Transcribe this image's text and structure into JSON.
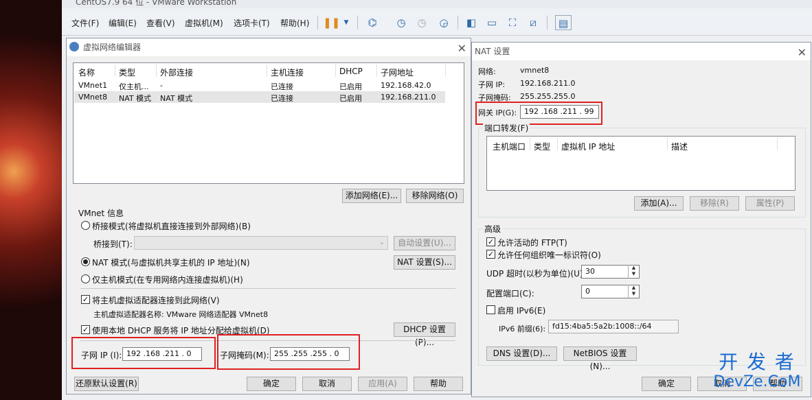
{
  "app": {
    "title": "CentOS7.9 64 位 - VMware Workstation"
  },
  "menus": [
    "文件(F)",
    "编辑(E)",
    "查看(V)",
    "虚拟机(M)",
    "选项卡(T)",
    "帮助(H)"
  ],
  "vne": {
    "title": "虚拟网络编辑器",
    "headers": [
      "名称",
      "类型",
      "外部连接",
      "主机连接",
      "DHCP",
      "子网地址"
    ],
    "rows": [
      [
        "VMnet1",
        "仅主机...",
        "-",
        "已连接",
        "已启用",
        "192.168.42.0"
      ],
      [
        "VMnet8",
        "NAT 模式",
        "NAT 模式",
        "已连接",
        "已启用",
        "192.168.211.0"
      ]
    ],
    "add_network": "添加网络(E)...",
    "remove_network": "移除网络(O)",
    "vmnet_info": "VMnet 信息",
    "bridge_mode": "桥接模式(将虚拟机直接连接到外部网络)(B)",
    "bridge_to": "桥接到(T):",
    "auto_settings": "自动设置(U)...",
    "nat_mode": "NAT 模式(与虚拟机共享主机的 IP 地址)(N)",
    "nat_settings": "NAT 设置(S)...",
    "host_only": "仅主机模式(在专用网络内连接虚拟机)(H)",
    "connect_adapter": "将主机虚拟适配器连接到此网络(V)",
    "adapter_name": "主机虚拟适配器名称: VMware 网络适配器 VMnet8",
    "use_dhcp": "使用本地 DHCP 服务将 IP 地址分配给虚拟机(D)",
    "dhcp_settings": "DHCP 设置(P)...",
    "subnet_ip_label": "子网 IP (I):",
    "subnet_ip": "192 .168 .211 . 0",
    "subnet_mask_label": "子网掩码(M):",
    "subnet_mask": "255 .255 .255 . 0",
    "restore_default": "还原默认设置(R)",
    "ok": "确定",
    "cancel": "取消",
    "apply": "应用(A)",
    "help": "帮助"
  },
  "nat": {
    "title": "NAT 设置",
    "network_label": "网络:",
    "network": "vmnet8",
    "subnet_ip_label": "子网 IP:",
    "subnet_ip": "192.168.211.0",
    "subnet_mask_label": "子网掩码:",
    "subnet_mask": "255.255.255.0",
    "gateway_label": "网关 IP(G):",
    "gateway": "192 .168 .211 . 99",
    "port_forward": "端口转发(F)",
    "pf_headers": [
      "主机端口",
      "类型",
      "虚拟机 IP 地址",
      "描述"
    ],
    "add": "添加(A)...",
    "remove": "移除(R)",
    "properties": "属性(P)",
    "advanced": "高级",
    "allow_ftp": "允许活动的 FTP(T)",
    "allow_oui": "允许任何组织唯一标识符(O)",
    "udp_label": "UDP 超时(以秒为单位)(U):",
    "udp_value": "30",
    "config_port_label": "配置端口(C):",
    "config_port_value": "0",
    "enable_ipv6": "启用 IPv6(E)",
    "ipv6_label": "IPv6 前缀(6):",
    "ipv6_value": "fd15:4ba5:5a2b:1008::/64",
    "dns": "DNS 设置(D)...",
    "netbios": "NetBIOS 设置(N)...",
    "ok": "确定",
    "cancel": "取消",
    "help": "帮助"
  },
  "watermark": {
    "cn": "开 发 者",
    "en": "DevZe.CoM"
  }
}
